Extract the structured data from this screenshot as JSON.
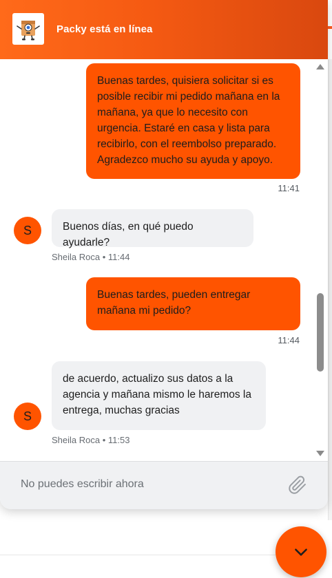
{
  "header": {
    "title": "Packy está en línea",
    "logo_icon": "packy-mascot-icon"
  },
  "messages": [
    {
      "direction": "outgoing",
      "text": "Buenas tardes, quisiera solicitar si es posible recibir mi pedido mañana en la mañana, ya que lo necesito con urgencia. Estaré en casa y lista para recibirlo, con el reembolso preparado. Agradezco mucho su ayuda y apoyo.",
      "time": "11:41"
    },
    {
      "direction": "incoming",
      "avatar_initial": "S",
      "text": "Buenos días, en qué puedo ayudarle?",
      "meta": "Sheila Roca • 11:44"
    },
    {
      "direction": "outgoing",
      "text": "Buenas tardes, pueden entregar mañana mi pedido?",
      "time": "11:44"
    },
    {
      "direction": "incoming",
      "avatar_initial": "S",
      "text": "de acuerdo, actualizo sus datos a la agencia y mañana mismo le haremos la entrega, muchas gracias",
      "meta": "Sheila Roca • 11:53"
    }
  ],
  "composer": {
    "placeholder": "No puedes escribir ahora",
    "attach_icon": "paperclip-icon"
  },
  "fab": {
    "icon": "chevron-down-icon"
  },
  "colors": {
    "brand": "#ff5400",
    "incoming_bubble": "#f0f1f3"
  }
}
